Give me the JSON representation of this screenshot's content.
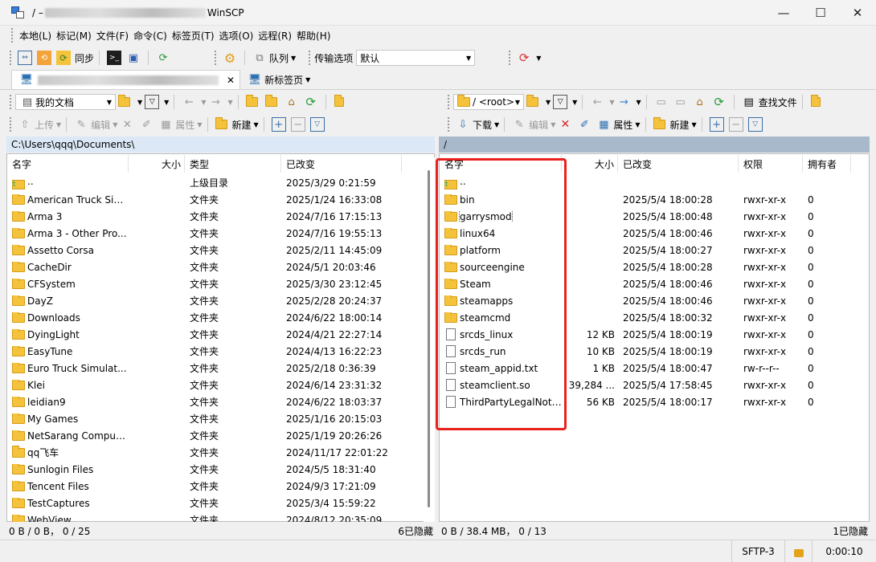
{
  "window": {
    "title_prefix": "/ –",
    "title_suffix": "WinSCP",
    "minimize": "—",
    "maximize": "☐",
    "close": "✕"
  },
  "menu": [
    "本地(L)",
    "标记(M)",
    "文件(F)",
    "命令(C)",
    "标签页(T)",
    "选项(O)",
    "远程(R)",
    "帮助(H)"
  ],
  "toolbar": {
    "sync_label": "同步",
    "queue_label": "队列",
    "transfer_options_label": "传输选项",
    "transfer_preset": "默认"
  },
  "tabs": {
    "new_tab_label": "新标签页"
  },
  "local": {
    "path_combo": "我的文档",
    "upload_label": "上传",
    "edit_label": "编辑",
    "properties_label": "属性",
    "new_label": "新建",
    "path": "C:\\Users\\qqq\\Documents\\",
    "columns": [
      "名字",
      "大小",
      "类型",
      "已改变"
    ],
    "rows": [
      {
        "name": "..",
        "size": "",
        "type": "上级目录",
        "changed": "2025/3/29 0:21:59",
        "kind": "up"
      },
      {
        "name": "American Truck Sim...",
        "size": "",
        "type": "文件夹",
        "changed": "2025/1/24 16:33:08",
        "kind": "folder"
      },
      {
        "name": "Arma 3",
        "size": "",
        "type": "文件夹",
        "changed": "2024/7/16 17:15:13",
        "kind": "folder"
      },
      {
        "name": "Arma 3 - Other Pro...",
        "size": "",
        "type": "文件夹",
        "changed": "2024/7/16 19:55:13",
        "kind": "folder"
      },
      {
        "name": "Assetto Corsa",
        "size": "",
        "type": "文件夹",
        "changed": "2025/2/11 14:45:09",
        "kind": "folder"
      },
      {
        "name": "CacheDir",
        "size": "",
        "type": "文件夹",
        "changed": "2024/5/1 20:03:46",
        "kind": "folder"
      },
      {
        "name": "CFSystem",
        "size": "",
        "type": "文件夹",
        "changed": "2025/3/30 23:12:45",
        "kind": "folder"
      },
      {
        "name": "DayZ",
        "size": "",
        "type": "文件夹",
        "changed": "2025/2/28 20:24:37",
        "kind": "folder"
      },
      {
        "name": "Downloads",
        "size": "",
        "type": "文件夹",
        "changed": "2024/6/22 18:00:14",
        "kind": "folder"
      },
      {
        "name": "DyingLight",
        "size": "",
        "type": "文件夹",
        "changed": "2024/4/21 22:27:14",
        "kind": "folder"
      },
      {
        "name": "EasyTune",
        "size": "",
        "type": "文件夹",
        "changed": "2024/4/13 16:22:23",
        "kind": "folder"
      },
      {
        "name": "Euro Truck Simulat...",
        "size": "",
        "type": "文件夹",
        "changed": "2025/2/18 0:36:39",
        "kind": "folder"
      },
      {
        "name": "Klei",
        "size": "",
        "type": "文件夹",
        "changed": "2024/6/14 23:31:32",
        "kind": "folder"
      },
      {
        "name": "leidian9",
        "size": "",
        "type": "文件夹",
        "changed": "2024/6/22 18:03:37",
        "kind": "folder"
      },
      {
        "name": "My Games",
        "size": "",
        "type": "文件夹",
        "changed": "2025/1/16 20:15:03",
        "kind": "folder"
      },
      {
        "name": "NetSarang Computer",
        "size": "",
        "type": "文件夹",
        "changed": "2025/1/19 20:26:26",
        "kind": "folder"
      },
      {
        "name": "qq飞车",
        "size": "",
        "type": "文件夹",
        "changed": "2024/11/17 22:01:22",
        "kind": "folder"
      },
      {
        "name": "Sunlogin Files",
        "size": "",
        "type": "文件夹",
        "changed": "2024/5/5 18:31:40",
        "kind": "folder"
      },
      {
        "name": "Tencent Files",
        "size": "",
        "type": "文件夹",
        "changed": "2024/9/3 17:21:09",
        "kind": "folder"
      },
      {
        "name": "TestCaptures",
        "size": "",
        "type": "文件夹",
        "changed": "2025/3/4 15:59:22",
        "kind": "folder"
      },
      {
        "name": "WebView",
        "size": "",
        "type": "文件夹",
        "changed": "2024/8/12 20:35:09",
        "kind": "folder"
      }
    ],
    "status_left": "0 B / 0 B，  0 / 25",
    "status_right": "6已隐藏"
  },
  "remote": {
    "path_combo": "/  <root>",
    "download_label": "下载",
    "edit_label": "编辑",
    "properties_label": "属性",
    "new_label": "新建",
    "find_files_label": "查找文件",
    "path": "/",
    "columns": [
      "名字",
      "大小",
      "已改变",
      "权限",
      "拥有者"
    ],
    "rows": [
      {
        "name": "..",
        "size": "",
        "changed": "",
        "rights": "",
        "owner": "",
        "kind": "up"
      },
      {
        "name": "bin",
        "size": "",
        "changed": "2025/5/4 18:00:28",
        "rights": "rwxr-xr-x",
        "owner": "0",
        "kind": "folder"
      },
      {
        "name": "garrysmod",
        "size": "",
        "changed": "2025/5/4 18:00:48",
        "rights": "rwxr-xr-x",
        "owner": "0",
        "kind": "folder"
      },
      {
        "name": "linux64",
        "size": "",
        "changed": "2025/5/4 18:00:46",
        "rights": "rwxr-xr-x",
        "owner": "0",
        "kind": "folder"
      },
      {
        "name": "platform",
        "size": "",
        "changed": "2025/5/4 18:00:27",
        "rights": "rwxr-xr-x",
        "owner": "0",
        "kind": "folder"
      },
      {
        "name": "sourceengine",
        "size": "",
        "changed": "2025/5/4 18:00:28",
        "rights": "rwxr-xr-x",
        "owner": "0",
        "kind": "folder"
      },
      {
        "name": "Steam",
        "size": "",
        "changed": "2025/5/4 18:00:46",
        "rights": "rwxr-xr-x",
        "owner": "0",
        "kind": "folder"
      },
      {
        "name": "steamapps",
        "size": "",
        "changed": "2025/5/4 18:00:46",
        "rights": "rwxr-xr-x",
        "owner": "0",
        "kind": "folder"
      },
      {
        "name": "steamcmd",
        "size": "",
        "changed": "2025/5/4 18:00:32",
        "rights": "rwxr-xr-x",
        "owner": "0",
        "kind": "folder"
      },
      {
        "name": "srcds_linux",
        "size": "12 KB",
        "changed": "2025/5/4 18:00:19",
        "rights": "rwxr-xr-x",
        "owner": "0",
        "kind": "file"
      },
      {
        "name": "srcds_run",
        "size": "10 KB",
        "changed": "2025/5/4 18:00:19",
        "rights": "rwxr-xr-x",
        "owner": "0",
        "kind": "file"
      },
      {
        "name": "steam_appid.txt",
        "size": "1 KB",
        "changed": "2025/5/4 18:00:47",
        "rights": "rw-r--r--",
        "owner": "0",
        "kind": "file"
      },
      {
        "name": "steamclient.so",
        "size": "39,284 ...",
        "changed": "2025/5/4 17:58:45",
        "rights": "rwxr-xr-x",
        "owner": "0",
        "kind": "file"
      },
      {
        "name": "ThirdPartyLegalNoti...",
        "size": "56 KB",
        "changed": "2025/5/4 18:00:17",
        "rights": "rwxr-xr-x",
        "owner": "0",
        "kind": "file"
      }
    ],
    "status_left": "0 B / 38.4 MB，  0 / 13",
    "status_right": "1已隐藏"
  },
  "statusbar": {
    "protocol": "SFTP-3",
    "elapsed": "0:00:10"
  },
  "colors": {
    "highlight_box": "#e8231d",
    "folder": "#f5c33b",
    "active_path_bg": "#dce8f5",
    "inactive_path_bg": "#a9b9cc"
  }
}
